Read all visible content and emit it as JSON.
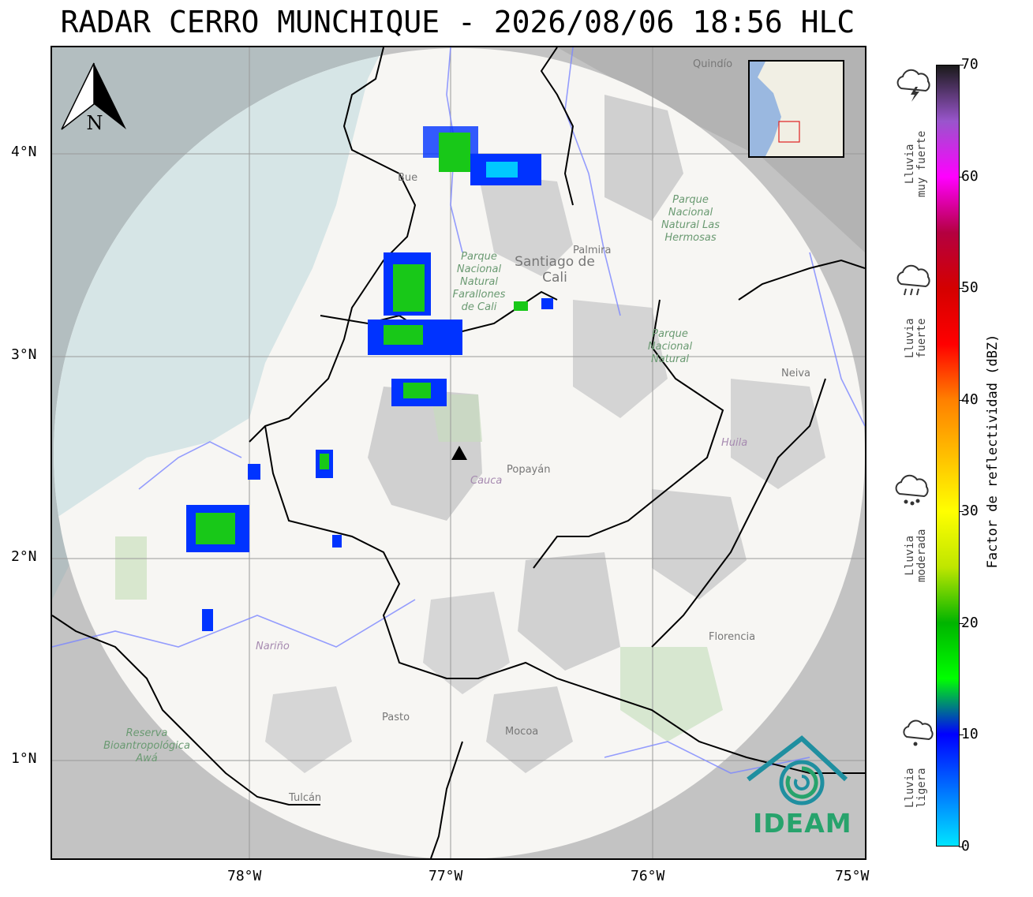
{
  "title": "RADAR CERRO MUNCHIQUE - 2026/08/06 18:56 HLC",
  "map": {
    "lon_range": [
      -79.0,
      -75.0
    ],
    "lat_range": [
      0.5,
      4.5
    ],
    "x_ticks": [
      "78°W",
      "77°W",
      "76°W",
      "75°W"
    ],
    "y_ticks": [
      "4°N",
      "3°N",
      "2°N",
      "1°N"
    ],
    "grid": true,
    "radar_site": {
      "name": "Cerro Munchique",
      "lon": -76.96,
      "lat": 2.5,
      "marker": "black-triangle"
    },
    "coverage_radius_deg": 2.0,
    "background_colors": {
      "sea": "#b7c9cc",
      "land": "#f6f5f2",
      "out_of_range": "#c3c3c3",
      "mountains": "#d6d6d6"
    },
    "places": [
      {
        "name": "Buenaventura",
        "shown": "Bue"
      },
      {
        "name": "Palmira"
      },
      {
        "name": "Santiago de Cali"
      },
      {
        "name": "Quindío"
      },
      {
        "name": "Popayán"
      },
      {
        "name": "Neiva"
      },
      {
        "name": "Florencia"
      },
      {
        "name": "Pasto"
      },
      {
        "name": "Mocoa"
      },
      {
        "name": "Tulcán"
      }
    ],
    "departments": [
      "Cauca",
      "Huila",
      "Nariño"
    ],
    "parks": [
      "Parque Nacional Natural Farallones de Cali",
      "Parque Nacional Natural Las Hermosas",
      "Parque Nacional Natural",
      "Reserva Bioantropológica Awá"
    ],
    "echoes": [
      {
        "lon": -77.0,
        "lat": 3.95,
        "dbz": 22
      },
      {
        "lon": -76.7,
        "lat": 3.85,
        "dbz": 11
      },
      {
        "lon": -77.2,
        "lat": 3.35,
        "dbz": 20
      },
      {
        "lon": -77.25,
        "lat": 3.05,
        "dbz": 17
      },
      {
        "lon": -77.15,
        "lat": 2.78,
        "dbz": 16
      },
      {
        "lon": -76.6,
        "lat": 3.23,
        "dbz": 14
      },
      {
        "lon": -77.6,
        "lat": 2.47,
        "dbz": 14
      },
      {
        "lon": -78.0,
        "lat": 2.14,
        "dbz": 18
      },
      {
        "lon": -78.22,
        "lat": 1.7,
        "dbz": 10
      },
      {
        "lon": -77.97,
        "lat": 2.42,
        "dbz": 9
      }
    ]
  },
  "colorbar": {
    "label": "Factor de reflectividad (dBZ)",
    "ticks": [
      "0",
      "10",
      "20",
      "30",
      "40",
      "50",
      "60",
      "70"
    ],
    "range": [
      0,
      70
    ],
    "stops": [
      {
        "v": 0,
        "c": "#00e5ff"
      },
      {
        "v": 10,
        "c": "#0000ff"
      },
      {
        "v": 15,
        "c": "#00ff00"
      },
      {
        "v": 20,
        "c": "#00b400"
      },
      {
        "v": 25,
        "c": "#bfe600"
      },
      {
        "v": 30,
        "c": "#ffff00"
      },
      {
        "v": 35,
        "c": "#ffbf00"
      },
      {
        "v": 40,
        "c": "#ff8000"
      },
      {
        "v": 45,
        "c": "#ff0000"
      },
      {
        "v": 50,
        "c": "#d40000"
      },
      {
        "v": 55,
        "c": "#b40040"
      },
      {
        "v": 60,
        "c": "#ff00ff"
      },
      {
        "v": 65,
        "c": "#9955cc"
      },
      {
        "v": 70,
        "c": "#1a1a1a"
      }
    ]
  },
  "rain_levels": [
    {
      "label": "Lluvia\nligera",
      "icon": "light-rain-icon"
    },
    {
      "label": "Lluvia\nmoderada",
      "icon": "moderate-rain-icon"
    },
    {
      "label": "Lluvia\nfuerte",
      "icon": "heavy-rain-icon"
    },
    {
      "label": "Lluvia\nmuy fuerte",
      "icon": "thunderstorm-icon"
    }
  ],
  "north_label": "N",
  "logo_text": "IDEAM"
}
